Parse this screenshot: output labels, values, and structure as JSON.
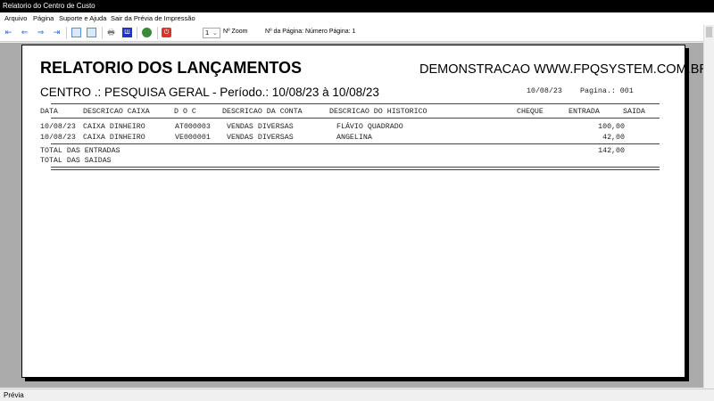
{
  "window": {
    "title": "Relatorio do Centro de Custo"
  },
  "menu": [
    "Arquivo",
    "Página",
    "Suporte e Ajuda",
    "Sair da Prévia de Impressão"
  ],
  "toolbar": {
    "zoom_value": "1",
    "zoom_label": "Nº Zoom",
    "page_label": "Nº da Página: Número Página: 1"
  },
  "report": {
    "title": "RELATORIO DOS LANÇAMENTOS",
    "company": "DEMONSTRACAO WWW.FPQSYSTEM.COM.BR",
    "subtitle": "CENTRO .: PESQUISA GERAL -  Período.: 10/08/23 à 10/08/23",
    "date": "10/08/23",
    "page": "Pagina.: 001",
    "headers": [
      "DATA",
      "DESCRICAO CAIXA",
      "D O C",
      "DESCRICAO DA CONTA",
      "DESCRICAO DO HISTORICO",
      "CHEQUE",
      "ENTRADA",
      "SAIDA"
    ],
    "rows": [
      [
        "10/08/23",
        "CAIXA DINHEIRO",
        "AT000003",
        "VENDAS DIVERSAS",
        "FLÁVIO QUADRADO",
        "",
        "100,00",
        ""
      ],
      [
        "10/08/23",
        "CAIXA DINHEIRO",
        "VE000001",
        "VENDAS DIVERSAS",
        "ANGELINA",
        "",
        "42,00",
        ""
      ]
    ],
    "total_entradas_label": "TOTAL DAS ENTRADAS",
    "total_entradas": "142,00",
    "total_saidas_label": "TOTAL DAS SAIDAS"
  },
  "status": "Prévia"
}
